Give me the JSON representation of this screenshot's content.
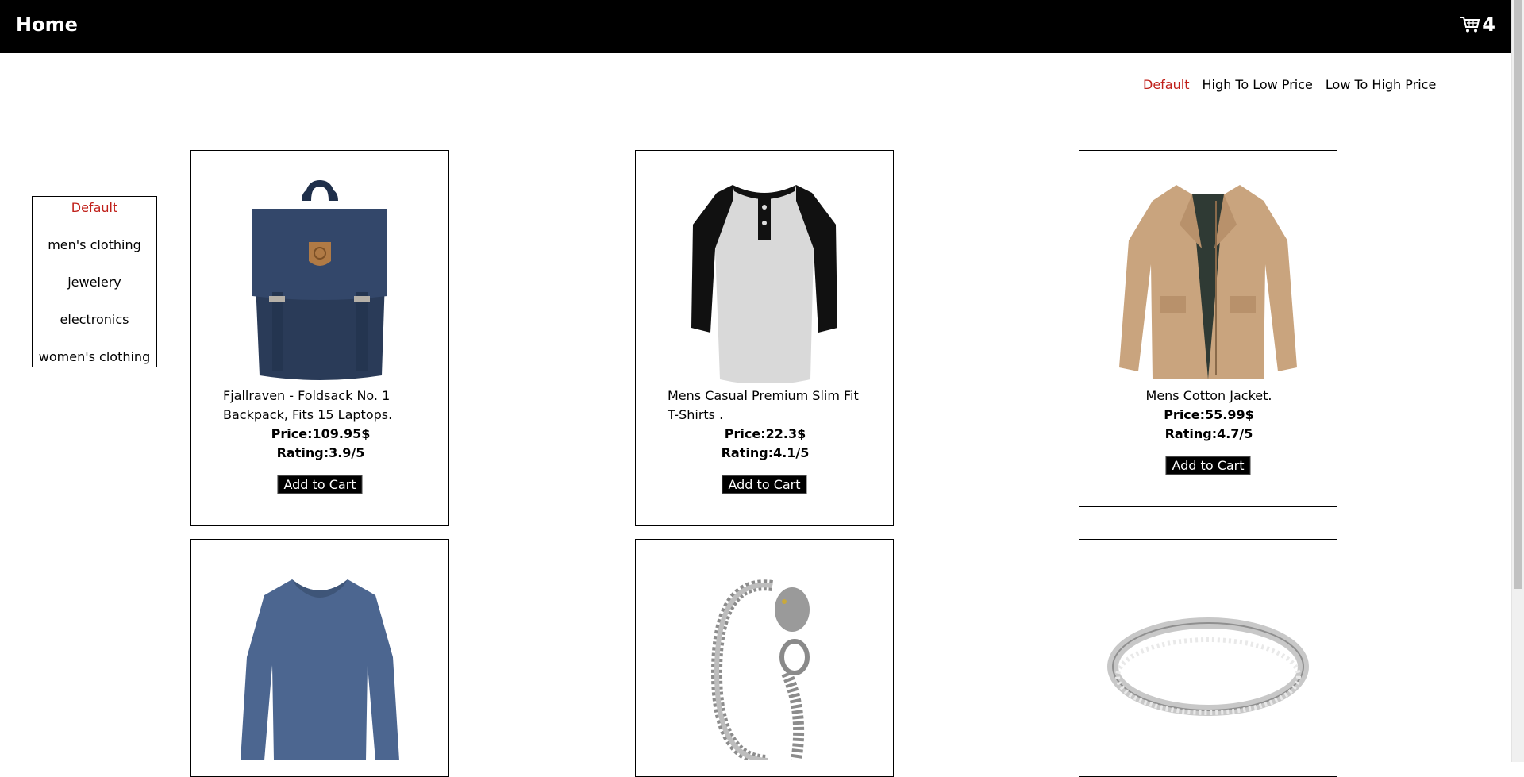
{
  "nav": {
    "home_label": "Home",
    "cart_count": "4",
    "cart_icon": "cart-icon"
  },
  "sort": {
    "options": [
      "Default",
      "High To Low Price",
      "Low To High Price"
    ],
    "active": "Default"
  },
  "categories": {
    "items": [
      "Default",
      "men's clothing",
      "jewelery",
      "electronics",
      "women's clothing"
    ],
    "active": "Default"
  },
  "products": [
    {
      "title": "Fjallraven - Foldsack No. 1 Backpack, Fits 15 Laptops.",
      "price": "Price:109.95$",
      "rating": "Rating:3.9/5",
      "button": "Add to Cart",
      "image": "backpack"
    },
    {
      "title": "Mens Casual Premium Slim Fit T-Shirts .",
      "price": "Price:22.3$",
      "rating": "Rating:4.1/5",
      "button": "Add to Cart",
      "image": "raglan-tshirt"
    },
    {
      "title": "Mens Cotton Jacket.",
      "price": "Price:55.99$",
      "rating": "Rating:4.7/5",
      "button": "Add to Cart",
      "image": "cotton-jacket"
    },
    {
      "image": "long-sleeve-shirt"
    },
    {
      "image": "dragon-bracelet"
    },
    {
      "image": "silver-ring"
    }
  ],
  "colors": {
    "nav_bg": "#000000",
    "active": "#c0201a",
    "button_bg": "#000000"
  }
}
